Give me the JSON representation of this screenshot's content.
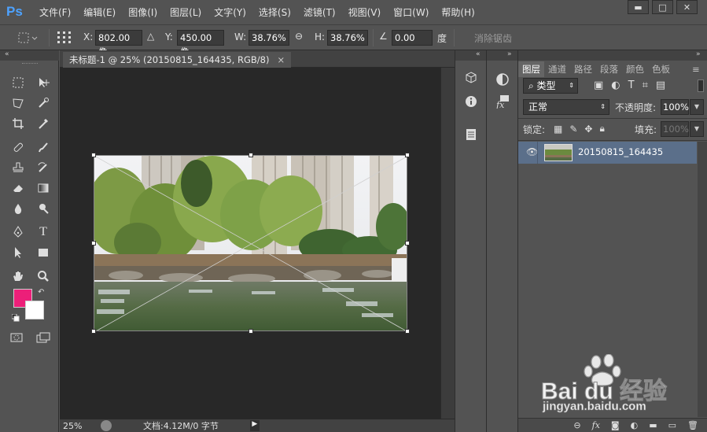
{
  "app": {
    "logo": "Ps"
  },
  "menu": [
    "文件(F)",
    "编辑(E)",
    "图像(I)",
    "图层(L)",
    "文字(Y)",
    "选择(S)",
    "滤镜(T)",
    "视图(V)",
    "窗口(W)",
    "帮助(H)"
  ],
  "window_controls": {
    "minimize": "▬",
    "maximize": "□",
    "close": "✕"
  },
  "options": {
    "x_label": "X:",
    "x_value": "802.00 像",
    "y_label": "Y:",
    "y_value": "450.00 像",
    "w_label": "W:",
    "w_value": "38.76%",
    "h_label": "H:",
    "h_value": "38.76%",
    "angle_value": "0.00",
    "angle_unit": "度",
    "antialias_label": "消除锯齿"
  },
  "document": {
    "tab_title": "未标题-1 @ 25% (20150815_164435, RGB/8)",
    "tab_close": "×",
    "zoom": "25%",
    "doc_info": "文档:4.12M/0 字节"
  },
  "layers_panel": {
    "tabs": [
      "图层",
      "通道",
      "路径",
      "段落",
      "颜色",
      "色板"
    ],
    "active_tab": "图层",
    "filter_kind": "类型",
    "blend_mode": "正常",
    "opacity_label": "不透明度:",
    "opacity_value": "100%",
    "lock_label": "锁定:",
    "fill_label": "填充:",
    "fill_value": "100%",
    "layer_name": "20150815_164435",
    "bottom_icons": [
      "link-icon",
      "fx-icon",
      "mask-icon",
      "adjustment-icon",
      "folder-icon",
      "new-layer-icon",
      "trash-icon"
    ]
  },
  "colors": {
    "foreground": "#ec1f79",
    "background": "#ffffff",
    "accent": "#4da2ff",
    "selected_layer": "#5b6f8a"
  },
  "watermark": {
    "text": "Bai du 经验",
    "url": "jingyan.baidu.com"
  }
}
